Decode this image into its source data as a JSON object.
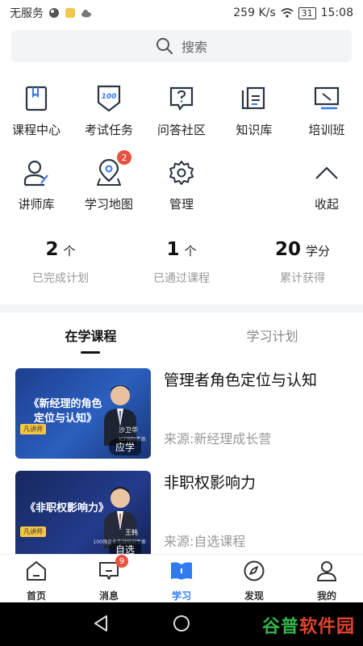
{
  "status_bar": {
    "carrier": "无服务",
    "net_speed": "259 K/s",
    "battery": "31",
    "time": "15:08"
  },
  "search": {
    "placeholder": "搜索"
  },
  "grid": {
    "row1": [
      {
        "label": "课程中心",
        "icon": "book-icon"
      },
      {
        "label": "考试任务",
        "icon": "exam-100-icon"
      },
      {
        "label": "问答社区",
        "icon": "question-bubble-icon"
      },
      {
        "label": "知识库",
        "icon": "knowledge-doc-icon"
      },
      {
        "label": "培训班",
        "icon": "training-board-icon"
      }
    ],
    "row2": [
      {
        "label": "讲师库",
        "icon": "lecturer-icon"
      },
      {
        "label": "学习地图",
        "icon": "map-pin-icon",
        "badge": "2"
      },
      {
        "label": "管理",
        "icon": "gear-icon"
      },
      {
        "label": "收起",
        "icon": "chevron-up-icon"
      }
    ]
  },
  "stats": [
    {
      "value": "2",
      "unit": "个",
      "caption": "已完成计划"
    },
    {
      "value": "1",
      "unit": "个",
      "caption": "已通过课程"
    },
    {
      "value": "20",
      "unit": "学分",
      "caption": "累计获得"
    }
  ],
  "tabs": [
    {
      "label": "在学课程",
      "active": true
    },
    {
      "label": "学习计划",
      "active": false
    }
  ],
  "courses": [
    {
      "title": "管理者角色定位与认知",
      "source": "来源:新经理成长营",
      "thumb_title_1": "《新经理的角色",
      "thumb_title_2": "定位与认知》",
      "thumb_brand": "凡讲师",
      "thumb_speaker": "沙卫华",
      "thumb_speaker_sub": "ICF国际教练",
      "thumb_tag": "应学"
    },
    {
      "title": "非职权影响力",
      "source": "来源:自选课程",
      "thumb_title_1": "《非职权影响力》",
      "thumb_title_2": "",
      "thumb_brand": "凡讲师",
      "thumb_speaker": "王韩",
      "thumb_speaker_sub": "100强企业实战培训专家",
      "thumb_tag": "自选"
    }
  ],
  "bottom_nav": [
    {
      "label": "首页",
      "icon": "home-icon"
    },
    {
      "label": "消息",
      "icon": "message-icon",
      "badge": "9"
    },
    {
      "label": "学习",
      "icon": "study-book-icon",
      "active": true
    },
    {
      "label": "发现",
      "icon": "compass-icon"
    },
    {
      "label": "我的",
      "icon": "profile-icon"
    }
  ],
  "watermark": {
    "part1": "谷普",
    "part2": "软件园"
  },
  "colors": {
    "accent": "#2f7bf6",
    "badge": "#e8533f",
    "watermark_green": "#33b44a"
  }
}
